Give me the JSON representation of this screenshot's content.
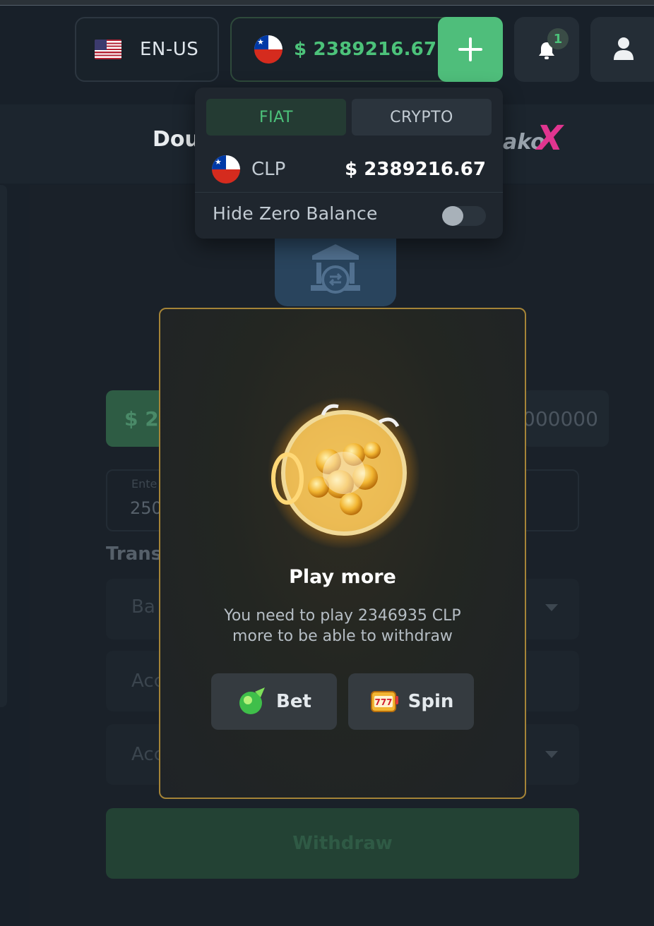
{
  "header": {
    "language_label": "EN-US",
    "balance": "$ 2389216.67",
    "notification_count": "1"
  },
  "brand": {
    "left_fragment": "Dou",
    "right_fragment": "ako",
    "logo_mark": "X"
  },
  "dropdown": {
    "tabs": [
      {
        "label": "FIAT",
        "active": true
      },
      {
        "label": "CRYPTO",
        "active": false
      }
    ],
    "currency": {
      "code": "CLP",
      "amount": "$ 2389216.67"
    },
    "hide_zero_label": "Hide Zero Balance",
    "hide_zero_enabled": false
  },
  "withdraw_form": {
    "amount_chip": "$ 25",
    "max_chip": "000000",
    "input_label": "Ente",
    "input_value": "250",
    "section_title": "Transa",
    "select_1": "Ba",
    "select_2": "Acc",
    "select_3": "Acc",
    "submit_label": "Withdraw"
  },
  "modal": {
    "title": "Play more",
    "description_line1": "You need to play 2346935 CLP",
    "description_line2": "more to be able to withdraw",
    "bet_label": "Bet",
    "spin_label": "Spin"
  },
  "colors": {
    "accent_green": "#4fbe7b",
    "modal_border": "#a58437",
    "background": "#182029"
  }
}
